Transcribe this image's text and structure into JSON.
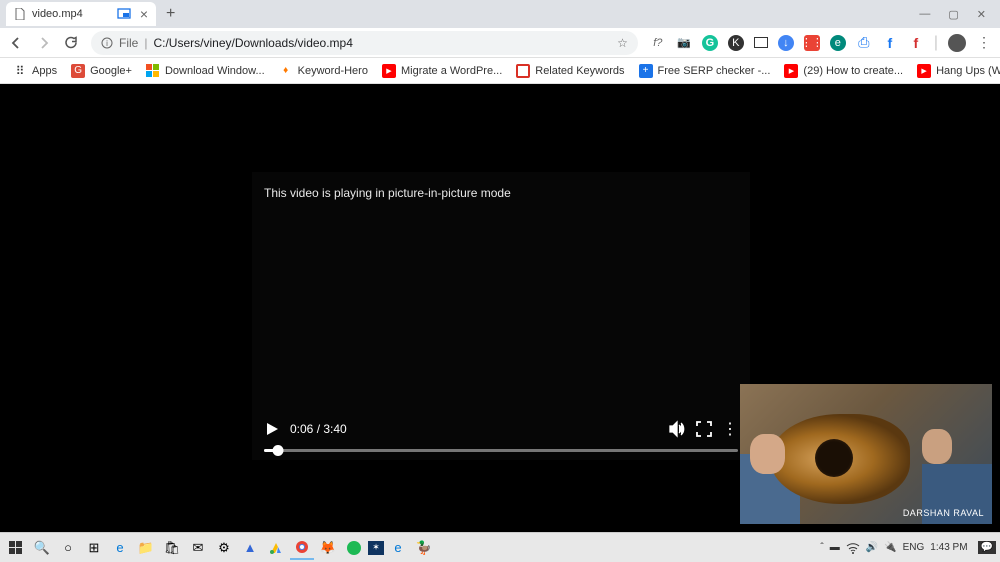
{
  "tab": {
    "title": "video.mp4"
  },
  "url": {
    "protocol": "File",
    "path": "C:/Users/viney/Downloads/video.mp4"
  },
  "bookmarks": [
    {
      "label": "Apps",
      "iconBg": "#fff",
      "iconColor": "#555"
    },
    {
      "label": "Google+",
      "iconBg": "#dd4b39",
      "iconColor": "#fff"
    },
    {
      "label": "Download Window...",
      "iconBg": "#fff",
      "iconColor": "#00a4ef"
    },
    {
      "label": "Keyword-Hero",
      "iconBg": "#fff",
      "iconColor": "#ff7a00"
    },
    {
      "label": "Migrate a WordPre...",
      "iconBg": "#ff0000",
      "iconColor": "#fff"
    },
    {
      "label": "Related Keywords",
      "iconBg": "#fff",
      "iconColor": "#d93025"
    },
    {
      "label": "Free SERP checker -...",
      "iconBg": "#1a73e8",
      "iconColor": "#fff"
    },
    {
      "label": "(29) How to create...",
      "iconBg": "#ff0000",
      "iconColor": "#fff"
    },
    {
      "label": "Hang Ups (Want Yo...",
      "iconBg": "#ff0000",
      "iconColor": "#fff"
    }
  ],
  "player": {
    "pipMessage": "This video is playing in picture-in-picture mode",
    "currentTime": "0:06",
    "duration": "3:40"
  },
  "pip": {
    "credit": "DARSHAN RAVAL"
  },
  "tray": {
    "lang": "ENG",
    "time": "1:43 PM"
  },
  "omniboxText": "f?"
}
